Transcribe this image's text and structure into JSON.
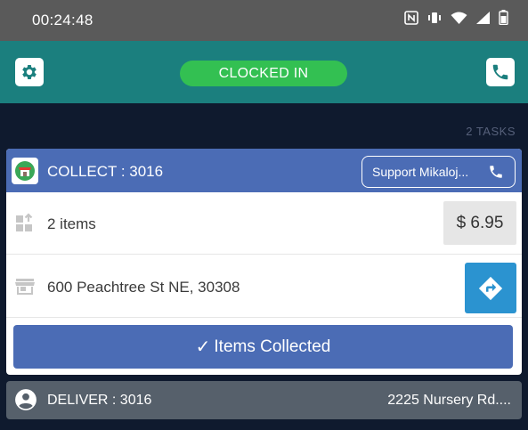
{
  "status_bar": {
    "time": "00:24:48",
    "icons": [
      "nfc-icon",
      "vibrate-icon",
      "wifi-icon",
      "signal-icon",
      "battery-icon"
    ]
  },
  "header": {
    "status_label": "CLOCKED IN",
    "status_color": "#33c052",
    "background_color": "#1b7f7e",
    "left_icon": "gear-icon",
    "right_icon": "phone-icon"
  },
  "tasks": {
    "count_label": "2 TASKS"
  },
  "collect_task": {
    "title": "COLLECT : 3016",
    "support_label": "Support Mikaloj...",
    "items_label": "2 items",
    "price": "$ 6.95",
    "address": "600 Peachtree St NE,  30308",
    "action_label": "Items Collected",
    "accent_color": "#4b6cb5",
    "directions_color": "#2b93d0"
  },
  "deliver_task": {
    "title": "DELIVER : 3016",
    "address": "2225 Nursery Rd...."
  }
}
